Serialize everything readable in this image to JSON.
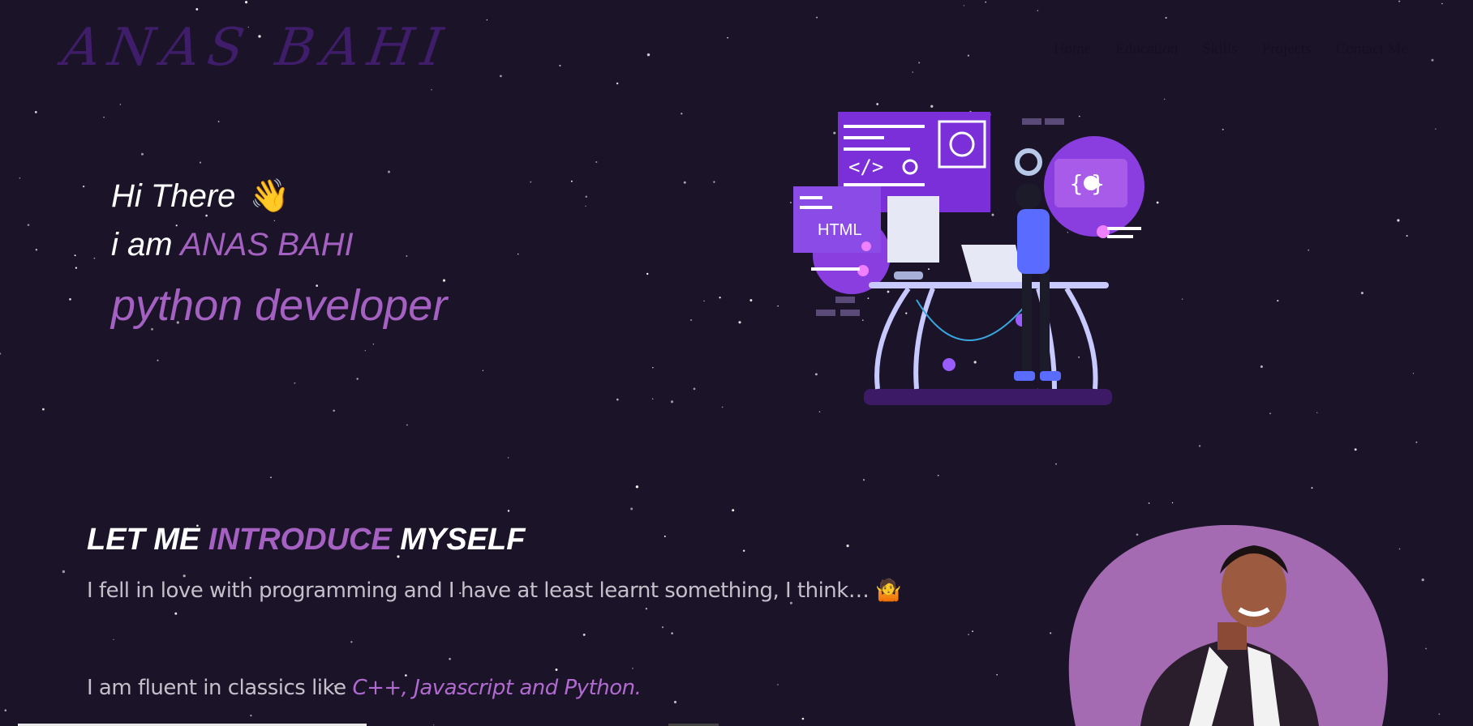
{
  "header": {
    "logo": "ANAS BAHI",
    "nav": [
      "Home",
      "Education",
      "Skills",
      "Projects",
      "Contact Me"
    ]
  },
  "hero": {
    "greeting": "Hi There",
    "greeting_emoji": "👋",
    "iam_prefix": "i am",
    "name": "ANAS BAHI",
    "role": "python developer"
  },
  "illustration": {
    "html_label": "HTML",
    "code_symbol": "</>",
    "braces_symbol": "{ }"
  },
  "intro": {
    "title_part1": "LET ME",
    "title_accent": "INTRODUCE",
    "title_part2": "MYSELF",
    "paragraph1": "I fell in love with programming and I have at least learnt something, I think…",
    "paragraph1_emoji": "🤷",
    "paragraph2_prefix": "I am fluent in classics like",
    "paragraph2_langs": "C++, Javascript and Python."
  },
  "colors": {
    "background": "#1b1428",
    "accent": "#a461c1",
    "logo": "#3f1d6b",
    "illustration_purple": "#7a2fd8"
  }
}
